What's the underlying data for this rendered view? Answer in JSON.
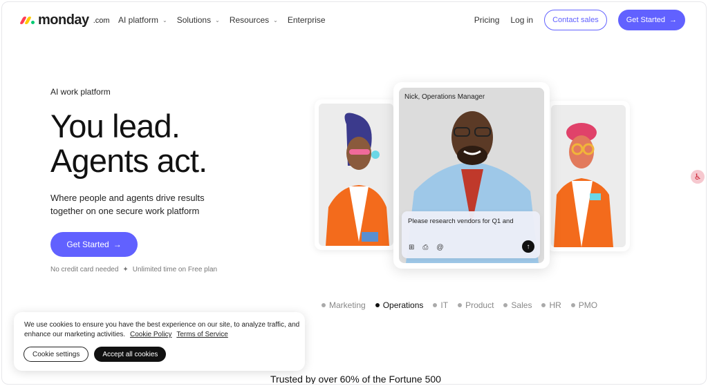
{
  "brand": {
    "name": "monday",
    "suffix": ".com",
    "colors": [
      "#ff3d57",
      "#ffcb00",
      "#00ca72"
    ]
  },
  "nav": {
    "items": [
      {
        "label": "AI platform",
        "has_dropdown": true
      },
      {
        "label": "Solutions",
        "has_dropdown": true
      },
      {
        "label": "Resources",
        "has_dropdown": true
      },
      {
        "label": "Enterprise",
        "has_dropdown": false
      }
    ],
    "pricing": "Pricing",
    "login": "Log in",
    "contact": "Contact sales",
    "get_started": "Get Started"
  },
  "hero": {
    "eyebrow": "AI work platform",
    "headline_1": "You lead.",
    "headline_2": "Agents act.",
    "subtitle": "Where people and agents drive results together on one secure work platform",
    "cta": "Get Started",
    "note_1": "No credit card needed",
    "note_sep": "✦",
    "note_2": "Unlimited time on Free plan"
  },
  "showcase": {
    "person_label": "Nick, Operations Manager",
    "prompt_text": "Please research vendors for Q1 and"
  },
  "categories": [
    {
      "label": "Marketing",
      "active": false
    },
    {
      "label": "Operations",
      "active": true
    },
    {
      "label": "IT",
      "active": false
    },
    {
      "label": "Product",
      "active": false
    },
    {
      "label": "Sales",
      "active": false
    },
    {
      "label": "HR",
      "active": false
    },
    {
      "label": "PMO",
      "active": false
    }
  ],
  "cookie": {
    "text": "We use cookies to ensure you have the best experience on our site, to analyze traffic, and enhance our marketing activities.",
    "policy_link": "Cookie Policy",
    "terms_link": "Terms of Service",
    "settings_btn": "Cookie settings",
    "accept_btn": "Accept all cookies"
  },
  "trusted": "Trusted by over 60% of the Fortune 500",
  "colors": {
    "primary": "#6161ff",
    "text": "#1f1f1f",
    "orange": "#f36b1c"
  }
}
